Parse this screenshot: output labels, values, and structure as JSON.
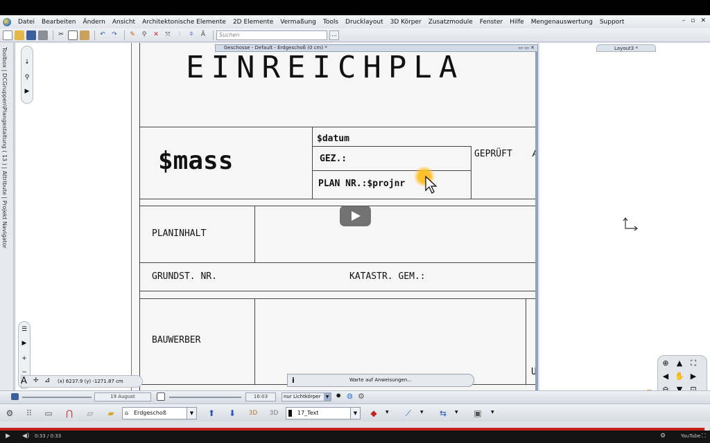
{
  "menu": [
    "Datei",
    "Bearbeiten",
    "Ändern",
    "Ansicht",
    "Architektonische Elemente",
    "2D Elemente",
    "Vermaßung",
    "Tools",
    "Drucklayout",
    "3D Körper",
    "Zusatzmodule",
    "Fenster",
    "Hilfe",
    "Mengenauswertung",
    "Support"
  ],
  "toolbar": {
    "search_placeholder": "Suchen",
    "search_button": "..."
  },
  "vertical_tabs": "Toolbox | DCGruppen\\Plangestaltung ( 13 ) | Attribute | Projekt Navigator",
  "sheet": {
    "window_title": "Geschosse - Default - Erdgeschoß (0 cm) *",
    "heading": "EINREICHPLA",
    "mass": "$mass",
    "datum": "$datum",
    "gez": "GEZ.:",
    "geprueft": "GEPRÜFT",
    "geprueft_cut": "A",
    "plan_nr": "PLAN NR.:$projnr",
    "planinhalt": "PLANINHALT",
    "grundst": "GRUNDST. NR.",
    "katastr": "KATASTR. GEM.:",
    "bauwerber": "BAUWERBER",
    "u_cut": "U"
  },
  "layout_tab": "Layout3 *",
  "status": {
    "coords": "(x) 6237.9  (y) -1271.87 cm",
    "wait": "Warte auf Anweisungen..."
  },
  "bottom": {
    "date": "19 August",
    "time": "16:03",
    "render_mode": "nur Lichtkörper",
    "floor": "Erdgeschoß",
    "layer": "17_Text"
  },
  "video": {
    "time": "0:33 / 0:33",
    "brand": "YouTube"
  },
  "colors": {
    "accent": "#c4201a",
    "panel": "#dfe3e8",
    "sheet_bg": "#f6f6f6",
    "cursor_glow": "#ffbe1e"
  }
}
